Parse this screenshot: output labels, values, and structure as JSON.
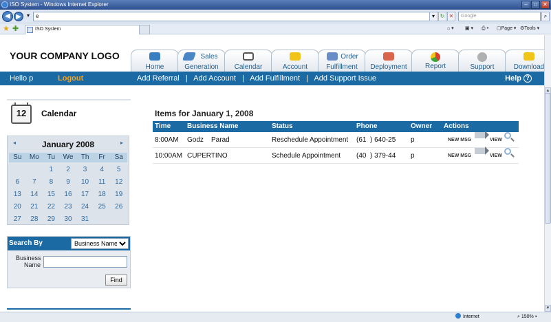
{
  "browser": {
    "window_title": "ISO System - Windows Internet Explorer",
    "address": "e",
    "search_placeholder": "Google",
    "tab_title": "ISO System",
    "page_menu": "Page",
    "tools_menu": "Tools",
    "status_zone": "Internet",
    "zoom": "150%"
  },
  "header": {
    "logo_text": "YOUR COMPANY LOGO",
    "tabs": [
      {
        "label": "Home",
        "icon": "home-icon",
        "color": "#3a7ec2"
      },
      {
        "label_line1": "Sales",
        "label_line2": "Generation",
        "icon": "sales-icon",
        "color": "#4a86c6"
      },
      {
        "label": "Calendar",
        "icon": "calendar-icon",
        "color": "#555555"
      },
      {
        "label": "Account",
        "icon": "folder-icon",
        "color": "#f0c419"
      },
      {
        "label_line1": "Order",
        "label_line2": "Fulfillment",
        "icon": "order-icon",
        "color": "#6a8cc7"
      },
      {
        "label": "Deployment",
        "icon": "deployment-icon",
        "color": "#d9654d"
      },
      {
        "label": "Report",
        "icon": "report-icon",
        "color": "#d93f2a"
      },
      {
        "label": "Support",
        "icon": "gear-icon",
        "color": "#9a9a9a"
      },
      {
        "label": "Download",
        "icon": "download-icon",
        "color": "#f0c419"
      }
    ]
  },
  "toolbar": {
    "hello": "Hello p",
    "logout": "Logout",
    "links": [
      "Add Referral",
      "Add Account",
      "Add Fulfillment",
      "Add Support Issue"
    ],
    "separator": "|",
    "help": "Help",
    "help_icon": "?"
  },
  "calendar": {
    "title": "Calendar",
    "icon_number": "12",
    "month": "January 2008",
    "prev": "◂",
    "next": "▸",
    "days_of_week": [
      "Su",
      "Mo",
      "Tu",
      "We",
      "Th",
      "Fr",
      "Sa"
    ],
    "days": [
      "",
      "",
      "1",
      "2",
      "3",
      "4",
      "5",
      "6",
      "7",
      "8",
      "9",
      "10",
      "11",
      "12",
      "13",
      "14",
      "15",
      "16",
      "17",
      "18",
      "19",
      "20",
      "21",
      "22",
      "23",
      "24",
      "25",
      "26",
      "27",
      "28",
      "29",
      "30",
      "31"
    ]
  },
  "search": {
    "title": "Search By",
    "selected_option": "Business Name",
    "field_label": "Business Name",
    "field_value": "",
    "button": "Find"
  },
  "items": {
    "title": "Items for January 1, 2008",
    "columns": [
      "Time",
      "Business Name",
      "Status",
      "Phone",
      "Owner",
      "Actions"
    ],
    "rows": [
      {
        "time": "8:00AM",
        "name": "Godz    Parad",
        "status": "Reschedule Appointment",
        "phone": "(61  ) 640-25",
        "owner": "p",
        "new_msg": "NEW MSG",
        "view": "VIEW"
      },
      {
        "time": "10:00AM",
        "name": "CUPERTINO",
        "status": "Schedule Appointment",
        "phone": "(40  ) 379-44",
        "owner": "p",
        "new_msg": "NEW MSG",
        "view": "VIEW"
      }
    ]
  }
}
